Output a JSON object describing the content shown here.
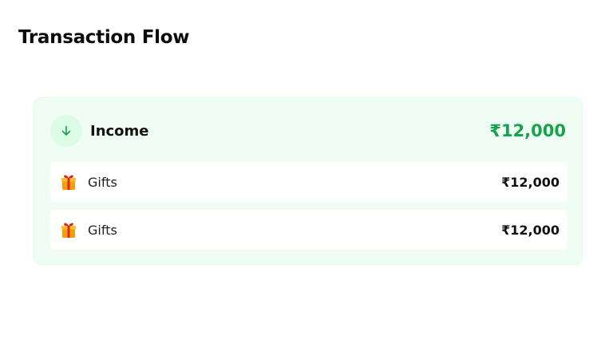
{
  "page": {
    "title": "Transaction Flow"
  },
  "income_card": {
    "category": "Income",
    "total": "₹12,000",
    "direction_icon": "arrow-down-icon",
    "accent_color": "#16a34a",
    "background_color": "#f0fdf4",
    "transactions": [
      {
        "icon": "gift-icon",
        "label": "Gifts",
        "amount": "₹12,000"
      },
      {
        "icon": "gift-icon",
        "label": "Gifts",
        "amount": "₹12,000"
      }
    ]
  }
}
